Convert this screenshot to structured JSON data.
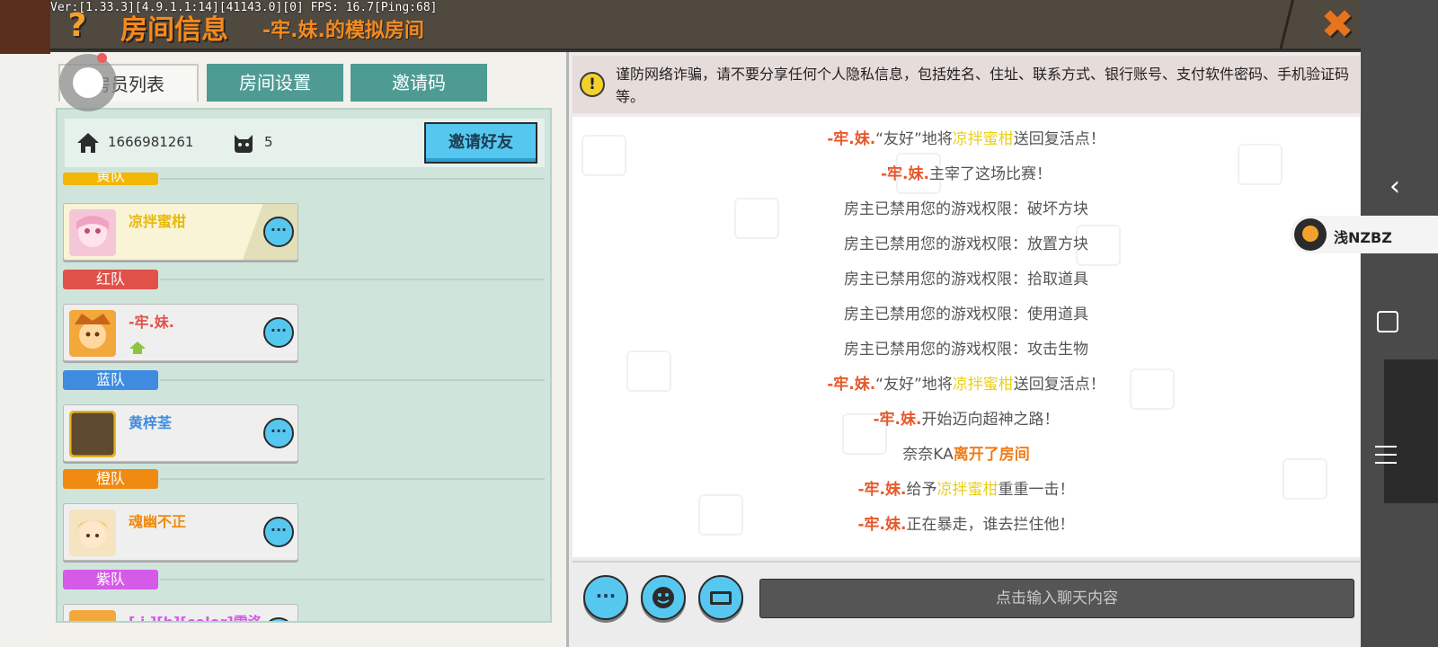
{
  "debug_text": "Ver:[1.33.3][4.9.1.1:14][41143.0][0] FPS: 16.7[Ping:68]",
  "title_bar": {
    "help_label": "?",
    "title": "房间信息",
    "subtitle": "-牢.妹.的模拟房间",
    "close_label": "✖"
  },
  "tabs": [
    {
      "label": "房员列表",
      "active": true
    },
    {
      "label": "房间设置",
      "active": false
    },
    {
      "label": "邀请码",
      "active": false
    }
  ],
  "room": {
    "id": "1666981261",
    "member_count": "5",
    "invite_friend_label": "邀请好友"
  },
  "teams": [
    {
      "name": "黄队",
      "color": "#f2b705"
    },
    {
      "name": "红队",
      "color": "#e0514a"
    },
    {
      "name": "蓝队",
      "color": "#3e8be0"
    },
    {
      "name": "橙队",
      "color": "#f08a10"
    },
    {
      "name": "紫队",
      "color": "#d65ae8"
    }
  ],
  "members": [
    {
      "name": "凉拌蜜柑",
      "color": "#e8b80b",
      "more_label": "···"
    },
    {
      "name": "-牢.妹.",
      "color": "#e0514a",
      "more_label": "···"
    },
    {
      "name": "黄梓荃",
      "color": "#3e8be0",
      "more_label": "···"
    },
    {
      "name": "魂幽不正",
      "color": "#f08a10",
      "more_label": "···"
    },
    {
      "name": "[ i ][b][color]雷洛",
      "color": "#d65ae8",
      "more_label": "···"
    }
  ],
  "warning": {
    "icon_label": "!",
    "text": "谨防网络诈骗，请不要分享任何个人隐私信息，包括姓名、住址、联系方式、银行账号、支付软件密码、手机验证码等。"
  },
  "chat": {
    "l0": {
      "a": "-牢.妹.",
      "b": "“友好”地将",
      "c": "凉拌蜜柑",
      "d": "送回复活点！"
    },
    "l1": {
      "a": "-牢.妹.",
      "b": "主宰了这场比赛！"
    },
    "l2": "房主已禁用您的游戏权限：破坏方块",
    "l3": "房主已禁用您的游戏权限：放置方块",
    "l4": "房主已禁用您的游戏权限：拾取道具",
    "l5": "房主已禁用您的游戏权限：使用道具",
    "l6": "房主已禁用您的游戏权限：攻击生物",
    "l7": {
      "a": "-牢.妹.",
      "b": "“友好”地将",
      "c": "凉拌蜜柑",
      "d": "送回复活点！"
    },
    "l8": {
      "a": "-牢.妹.",
      "b": "开始迈向超神之路！"
    },
    "l9": {
      "a": "奈奈KA",
      "b": "离开了房间"
    },
    "l10": {
      "a": "-牢.妹.",
      "b": "给予",
      "c": "凉拌蜜柑",
      "d": "重重一击！"
    },
    "l11": {
      "a": "-牢.妹.",
      "b": "正在暴走，谁去拦住他！"
    }
  },
  "chat_bottom": {
    "more_label": "···",
    "input_placeholder": "点击输入聊天内容"
  },
  "overlay": {
    "vpn_label": "浅NZBZ",
    "back_label": "‹"
  }
}
